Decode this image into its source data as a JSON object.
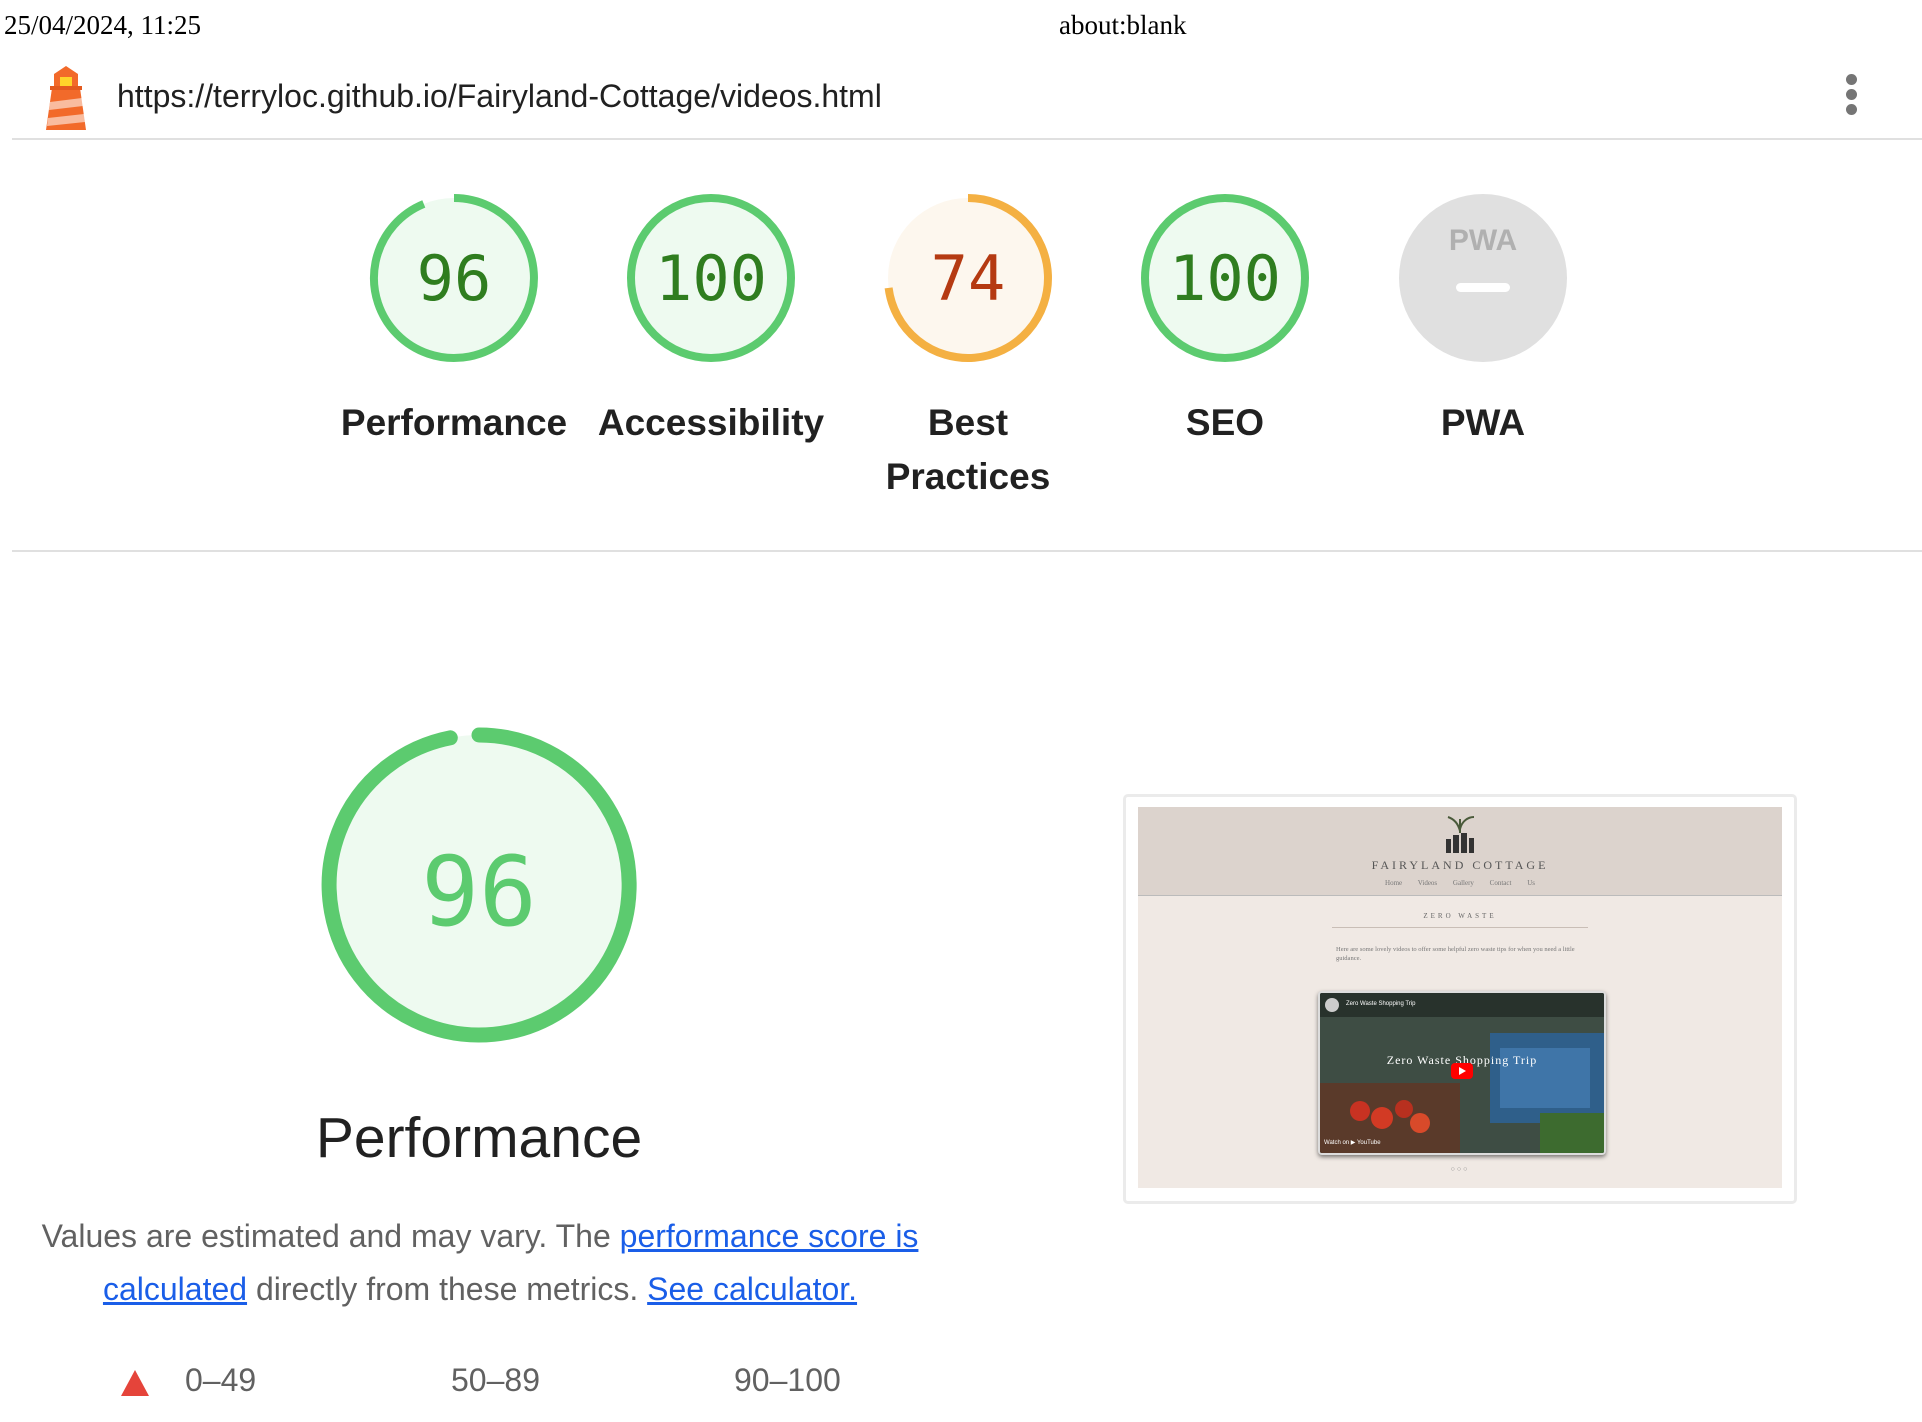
{
  "print_header": {
    "date": "25/04/2024, 11:25",
    "url": "about:blank"
  },
  "report": {
    "url": "https://terryloc.github.io/Fairyland-Cottage/videos.html"
  },
  "categories": [
    {
      "label": "Performance",
      "score": 96,
      "score_text": "96",
      "status": "pass"
    },
    {
      "label": "Accessibility",
      "score": 100,
      "score_text": "100",
      "status": "pass"
    },
    {
      "label": "Best Practices",
      "score": 74,
      "score_text": "74",
      "status": "average"
    },
    {
      "label": "SEO",
      "score": 100,
      "score_text": "100",
      "status": "pass"
    },
    {
      "label": "PWA",
      "score": null,
      "score_text": "PWA",
      "status": "na"
    }
  ],
  "colors": {
    "pass": "#0cce6b",
    "pass_arc": "#5ccb6f",
    "pass_text": "#2f7d1f",
    "pass_fill": "#eefaf0",
    "average_arc": "#f4b042",
    "average_text": "#b53a12",
    "average_fill": "#fdf7ee",
    "na_fill": "#e0e0e0",
    "fail": "#e5443a",
    "link": "#1a5ee8"
  },
  "performance": {
    "score": 96,
    "score_text": "96",
    "title": "Performance",
    "desc_prefix": "Values are estimated and may vary. The ",
    "link1": "performance score is calculated",
    "desc_middle": " directly from these metrics. ",
    "link2": "See calculator."
  },
  "legend": [
    {
      "range": "0–49",
      "icon": "red-triangle-icon"
    },
    {
      "range": "50–89",
      "icon": "orange-square-icon"
    },
    {
      "range": "90–100",
      "icon": "green-circle-icon"
    }
  ],
  "screenshot": {
    "brand": "FAIRYLAND COTTAGE",
    "nav": [
      "Home",
      "Videos",
      "Gallery",
      "Contact Us"
    ],
    "heading": "ZERO WASTE",
    "intro": "Here are some lovely videos to offer some helpful zero waste tips for when you need a little guidance.",
    "video_small_title": "Zero Waste Shopping Trip",
    "video_title": "Zero Waste Shopping Trip",
    "watch_on": "Watch on ▶ YouTube",
    "dots": "○○○"
  }
}
